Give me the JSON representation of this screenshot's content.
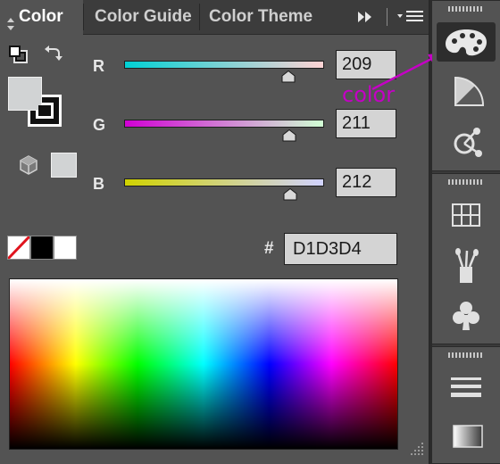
{
  "tabs": [
    {
      "label": "Color",
      "active": true
    },
    {
      "label": "Color Guide",
      "active": false
    },
    {
      "label": "Color Theme",
      "active": false
    }
  ],
  "tab_controls": {
    "collapse_icon": "double-chevron-right-icon",
    "menu_icon": "panel-menu-icon"
  },
  "fill_stroke": {
    "fill_color": "#d1d3d4",
    "stroke_color": "#000000",
    "swap_icon": "swap-arrows-icon",
    "default_icon": "default-fill-stroke-icon"
  },
  "gamut": {
    "cube_icon": "out-of-web-gamut-cube-icon",
    "swatch_color": "#d1d3d4"
  },
  "channels": [
    {
      "label": "R",
      "value": "209",
      "fraction": 0.8196,
      "gradient_from": "#00d1d4",
      "gradient_to": "#ffd3d4"
    },
    {
      "label": "G",
      "value": "211",
      "fraction": 0.8275,
      "gradient_from": "#d100d4",
      "gradient_to": "#d1ffd4"
    },
    {
      "label": "B",
      "value": "212",
      "fraction": 0.8314,
      "gradient_from": "#d1d300",
      "gradient_to": "#d1d3ff"
    }
  ],
  "hex": {
    "symbol": "#",
    "value": "D1D3D4"
  },
  "quick_swatches": [
    {
      "name": "none-swatch",
      "color": "none"
    },
    {
      "name": "black-swatch",
      "color": "#000000"
    },
    {
      "name": "white-swatch",
      "color": "#ffffff"
    }
  ],
  "annotation": {
    "text": "color",
    "color": "#c400c4"
  },
  "dock": {
    "groups": [
      {
        "buttons": [
          "color-palette-icon",
          "color-guide-icon",
          "color-theme-icon"
        ],
        "active": "color-palette-icon"
      },
      {
        "buttons": [
          "swatches-grid-icon",
          "brushes-icon",
          "symbols-club-icon"
        ]
      },
      {
        "buttons": [
          "stroke-lines-icon",
          "gradient-icon"
        ]
      }
    ]
  }
}
